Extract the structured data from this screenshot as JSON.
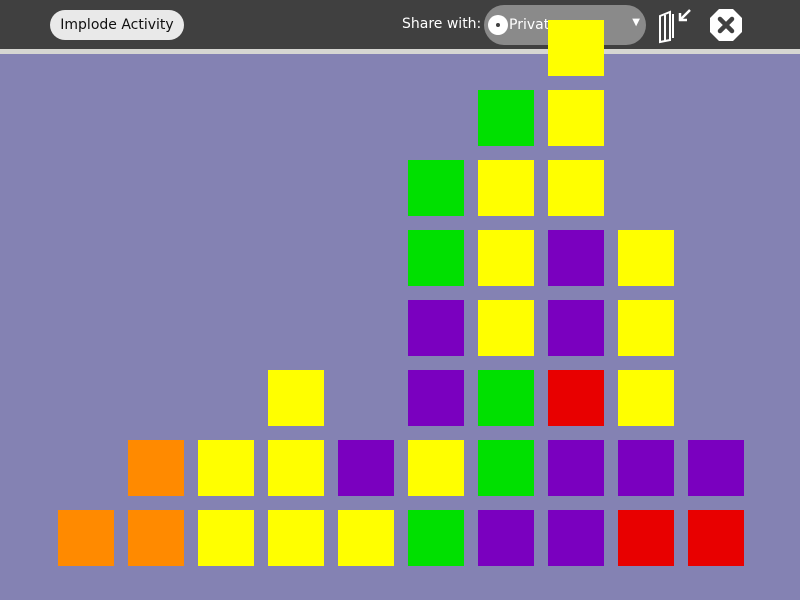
{
  "toolbar": {
    "implode_label": "Implode Activity",
    "share_label": "Share with:",
    "share_value": "Private",
    "keep_icon": "journal-keep-icon",
    "stop_icon": "stop-icon"
  },
  "colors": {
    "O": "#ff8a00",
    "Y": "#ffff00",
    "G": "#00e000",
    "P": "#7a00bf",
    "R": "#e80000"
  },
  "board": {
    "columns": 10,
    "rows": 7,
    "grid_bottom_to_top": [
      [
        "O"
      ],
      [
        "O",
        "O"
      ],
      [
        "Y",
        "Y"
      ],
      [
        "Y",
        "Y",
        "Y"
      ],
      [
        "Y",
        "P"
      ],
      [
        "G",
        "Y",
        "P",
        "P",
        "G",
        "G"
      ],
      [
        "P",
        "G",
        "G",
        "Y",
        "Y",
        "Y",
        "G"
      ],
      [
        "P",
        "P",
        "R",
        "P",
        "P",
        "Y",
        "Y",
        "Y"
      ],
      [
        "R",
        "P",
        "Y",
        "Y",
        "Y"
      ],
      [
        "R",
        "P"
      ]
    ]
  }
}
